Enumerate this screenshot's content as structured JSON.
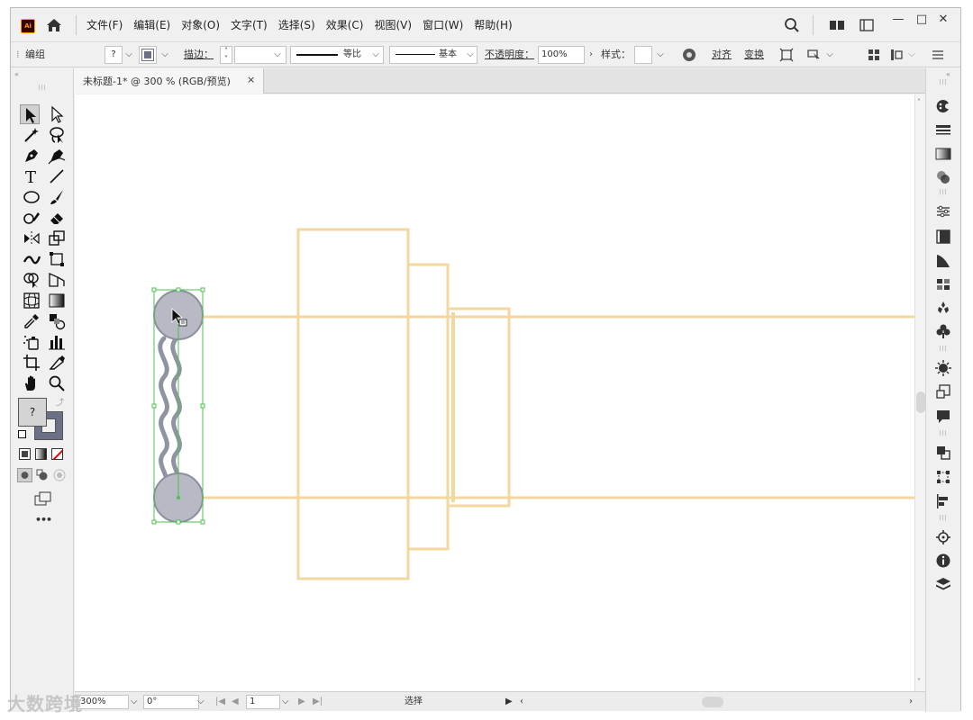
{
  "app": {
    "logo_text": "Ai"
  },
  "menu": [
    "文件(F)",
    "编辑(E)",
    "对象(O)",
    "文字(T)",
    "选择(S)",
    "效果(C)",
    "视图(V)",
    "窗口(W)",
    "帮助(H)"
  ],
  "window_controls": {
    "minimize": "—",
    "maximize": "□",
    "close": "✕"
  },
  "control_bar": {
    "selection_label": "编组",
    "fill_value": "?",
    "stroke_label": "描边：",
    "profile_label": "等比",
    "brush_label": "基本",
    "opacity_label": "不透明度：",
    "opacity_value": "100%",
    "style_label": "样式：",
    "align_label": "对齐",
    "transform_label": "变换"
  },
  "document_tab": {
    "title": "未标题-1* @ 300 % (RGB/预览)",
    "close": "×"
  },
  "toolbar": {
    "fill_unknown": "?",
    "more": "•••"
  },
  "status_bar": {
    "zoom": "300%",
    "rotation": "0°",
    "artboard": "1",
    "tool_status": "选择"
  },
  "watermark": "大数跨境",
  "colors": {
    "cap_fill": "#b7b9c5",
    "cap_stroke": "#8c8f9e",
    "wave_stroke": "#9093a2",
    "selection_green": "#4fc04f",
    "shape_stroke": "#f2d79f",
    "panel_bg": "#f0f0f0"
  }
}
